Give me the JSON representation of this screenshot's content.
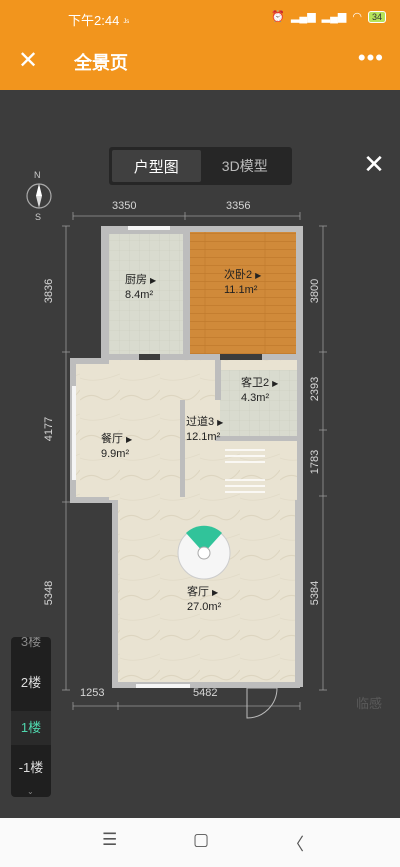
{
  "status": {
    "time": "下午2:44",
    "extra": "ᴶˢ",
    "battery": "34"
  },
  "appbar": {
    "title": "全景页",
    "close": "✕",
    "more": "•••"
  },
  "viewer": {
    "toggle": [
      {
        "label": "户型图",
        "active": true
      },
      {
        "label": "3D模型",
        "active": false
      }
    ],
    "close": "✕"
  },
  "compass": {
    "n": "N",
    "s": "S"
  },
  "dimensions": {
    "top_left": "3350",
    "top_right": "3356",
    "left_1": "3836",
    "left_2": "4177",
    "left_3": "5348",
    "right_1": "3800",
    "right_2": "2393",
    "right_3": "1783",
    "right_4": "5384",
    "bottom_left": "1253",
    "bottom_right": "5482"
  },
  "rooms": [
    {
      "name": "厨房",
      "area": "8.4m²"
    },
    {
      "name": "次卧2",
      "area": "11.1m²"
    },
    {
      "name": "客卫2",
      "area": "4.3m²"
    },
    {
      "name": "过道3",
      "area": "12.1m²"
    },
    {
      "name": "餐厅",
      "area": "9.9m²"
    },
    {
      "name": "客厅",
      "area": "27.0m²"
    }
  ],
  "floors": {
    "partial_top": "3楼",
    "items": [
      "2楼",
      "1楼",
      "-1楼"
    ],
    "active": "1楼"
  },
  "watermark": "临感",
  "colors": {
    "accent": "#f2951d",
    "active_floor": "#4fd6ad",
    "bedroom": "#d48c3a",
    "floor_tile": "#e8e1cf",
    "viewpoint": "#31c39a"
  }
}
